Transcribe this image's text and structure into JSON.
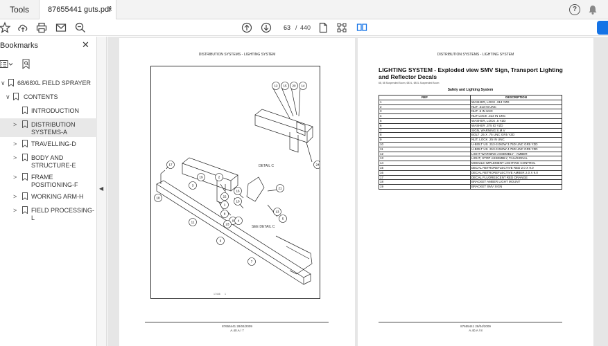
{
  "tabs": {
    "tools": "Tools",
    "document": "87655441 guts.pdf (...",
    "close_glyph": "×"
  },
  "toolbar": {
    "current_page": "63",
    "separator": "/",
    "total_pages": "440"
  },
  "sidebar": {
    "title": "Bookmarks",
    "close_glyph": "✕",
    "items": [
      {
        "label": "68/68XL FIELD SPRAYER",
        "arrow": "∨",
        "level": 0
      },
      {
        "label": "CONTENTS",
        "arrow": "∨",
        "level": 1
      },
      {
        "label": "INTRODUCTION",
        "arrow": "",
        "level": 2
      },
      {
        "label": "DISTRIBUTION SYSTEMS-A",
        "arrow": ">",
        "level": 2,
        "selected": true
      },
      {
        "label": "TRAVELLING-D",
        "arrow": ">",
        "level": 2
      },
      {
        "label": "BODY AND STRUCTURE-E",
        "arrow": ">",
        "level": 2
      },
      {
        "label": "FRAME POSITIONING-F",
        "arrow": ">",
        "level": 2
      },
      {
        "label": "WORKING ARM-H",
        "arrow": ">",
        "level": 2
      },
      {
        "label": "FIELD PROCESSING-L",
        "arrow": ">",
        "level": 2
      }
    ]
  },
  "left_page": {
    "header": "DISTRIBUTION SYSTEMS - LIGHTING SYSTEM",
    "detail_label": "DETAIL C",
    "see_detail_label": "SEE DETAIL C",
    "image_id": "17446",
    "image_index": "1",
    "footer_doc": "87655441 28/04/2009",
    "footer_page": "A.40.A / 7",
    "balloons": [
      "12",
      "15",
      "20",
      "14",
      "24",
      "21",
      "2",
      "22",
      "16",
      "10",
      "1",
      "8",
      "9",
      "4",
      "13",
      "5",
      "3",
      "19",
      "17",
      "23",
      "18",
      "11",
      "6",
      "7"
    ]
  },
  "right_page": {
    "header": "DISTRIBUTION SYSTEMS - LIGHTING SYSTEM",
    "title": "LIGHTING SYSTEM - Exploded view SMV Sign, Transport Lighting and Reflector Decals",
    "subtitle": "68, 68 Suspended Boom, 68XL, 68XL Suspended Boom",
    "table_title": "Safety and Lighting System",
    "columns": [
      "REF",
      "DESCRIPTION"
    ],
    "rows": [
      [
        "1",
        "WASHER, LOCK .313 YZD"
      ],
      [
        "2",
        "NUT .313 IN UNC"
      ],
      [
        "3",
        "NUT .5 IN UNC"
      ],
      [
        "4",
        "NUT LOCK .313 IN UNC"
      ],
      [
        "5",
        "WASHER, LOCK .5 YZD"
      ],
      [
        "6",
        "WASHER .375 ID YZD"
      ],
      [
        "7",
        "SIGN, WARNING S.M.V"
      ],
      [
        "8",
        "BOLT .25 X .75 UNC GR5 YZD"
      ],
      [
        "9",
        "NUT, LOCK .25 IN UNC"
      ],
      [
        "10",
        "U-BOLT US .313-3.063W 3.75D UNC GR5 YZD"
      ],
      [
        "11",
        "U-BOLT US .313-3.063W 4.75D UNC GR5 YZD"
      ],
      [
        "12",
        "LIGHT WARNING ASSEMBLY - AMBER"
      ],
      [
        "13",
        "LIGHT, STOP ASSEMBLY, TAIL/SIGNAL"
      ],
      [
        "14",
        "MODULE IMPLEMENT LIGHTING CONTROL"
      ],
      [
        "15",
        "DECAL RETROREFLECTIVE RED 2.0 X 9.0"
      ],
      [
        "16",
        "DECAL RETROREFLECTIVE AMBER 2.0 X 9.0"
      ],
      [
        "17",
        "DECAL FLUORESCENT RED ORANGE"
      ],
      [
        "18",
        "BRACKET AMBER LIGHT MOUNT"
      ],
      [
        "19",
        "BRACKET SMV SIGN"
      ]
    ],
    "footer_doc": "87655441 28/04/2009",
    "footer_page": "A.40.A / 8"
  },
  "colors": {
    "accent": "#1473e6",
    "sidebar_selected": "#e8e8e8",
    "viewer_bg": "#e6e6e6"
  },
  "icons": [
    "star-icon",
    "upload-icon",
    "print-icon",
    "mail-icon",
    "zoom-out-icon",
    "page-up-icon",
    "page-down-icon",
    "page-icon",
    "thumbnails-icon",
    "two-page-icon",
    "help-icon",
    "bell-icon",
    "options-icon",
    "bookmark-search-icon",
    "bookmark-icon"
  ]
}
